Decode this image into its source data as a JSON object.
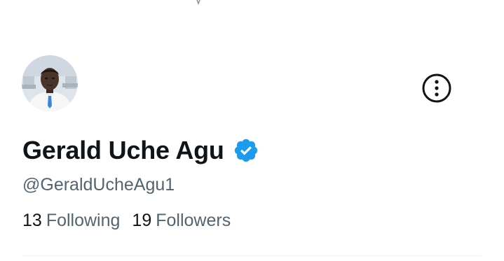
{
  "profile": {
    "display_name": "Gerald Uche Agu",
    "handle": "@GeraldUcheAgu1",
    "verified": true
  },
  "stats": {
    "following_count": "13",
    "following_label": "Following",
    "followers_count": "19",
    "followers_label": "Followers"
  },
  "icons": {
    "more": "more-options-icon",
    "verified": "verified-badge-icon"
  },
  "colors": {
    "text_primary": "#0f1419",
    "text_secondary": "#536471",
    "verified_blue": "#1d9bf0",
    "divider": "#eff3f4"
  }
}
